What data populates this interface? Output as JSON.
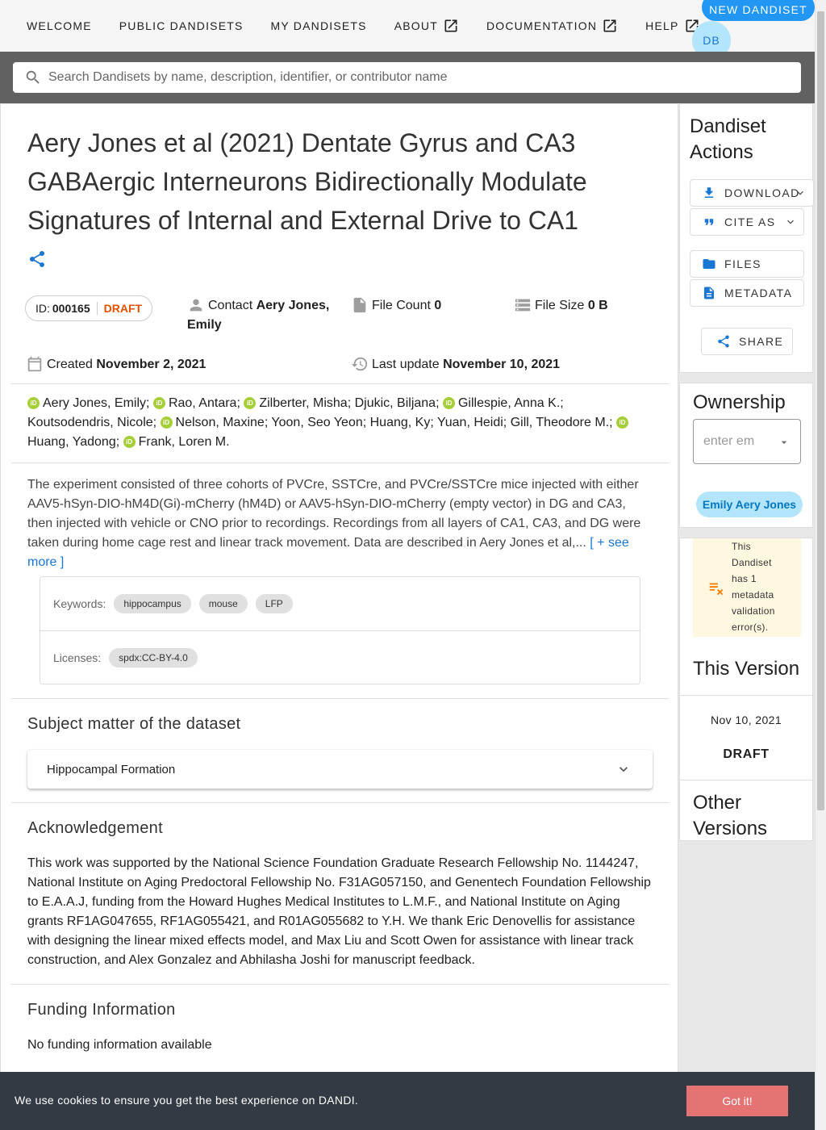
{
  "nav": {
    "items": [
      {
        "label": "WELCOME",
        "external": false
      },
      {
        "label": "PUBLIC DANDISETS",
        "external": false
      },
      {
        "label": "MY DANDISETS",
        "external": false
      },
      {
        "label": "ABOUT",
        "external": true
      },
      {
        "label": "DOCUMENTATION",
        "external": true
      },
      {
        "label": "HELP",
        "external": true
      }
    ],
    "new_dandiset": "NEW DANDISET",
    "avatar_initials": "DB"
  },
  "search": {
    "placeholder": "Search Dandisets by name, description, identifier, or contributor name",
    "value": ""
  },
  "dandiset": {
    "title": "Aery Jones et al (2021) Dentate Gyrus and CA3 GABAergic Interneurons Bidirectionally Modulate Signatures of Internal and External Drive to CA1",
    "id_label": "ID:",
    "id": "000165",
    "status": "DRAFT",
    "contact_label": "Contact",
    "contact_name": "Aery Jones,",
    "contact_name2": "Emily",
    "file_count_label": "File Count",
    "file_count": "0",
    "file_size_label": "File Size",
    "file_size": "0 B",
    "created_label": "Created",
    "created": "November 2, 2021",
    "updated_label": "Last update",
    "updated": "November 10, 2021",
    "contributors": [
      {
        "name": "Aery Jones, Emily",
        "orcid": true
      },
      {
        "name": "Rao, Antara",
        "orcid": true
      },
      {
        "name": "Zilberter, Misha",
        "orcid": true
      },
      {
        "name": "Djukic, Biljana",
        "orcid": false
      },
      {
        "name": "Gillespie, Anna K.",
        "orcid": true
      },
      {
        "name": "Koutsodendris, Nicole",
        "orcid": false
      },
      {
        "name": "Nelson, Maxine",
        "orcid": true
      },
      {
        "name": "Yoon, Seo Yeon",
        "orcid": false
      },
      {
        "name": "Huang, Ky",
        "orcid": false
      },
      {
        "name": "Yuan, Heidi",
        "orcid": false
      },
      {
        "name": "Gill, Theodore M.",
        "orcid": false
      },
      {
        "name": "Huang, Yadong",
        "orcid": true
      },
      {
        "name": "Frank, Loren M.",
        "orcid": true
      }
    ],
    "description": "The experiment consisted of three cohorts of PVCre, SSTCre, and PVCre/SSTCre mice injected with either AAV5-hSyn-DIO-hM4D(Gi)-mCherry (hM4D) or AAV5-hSyn-DIO-mCherry (empty vector) in DG and CA3, then injected with vehicle or CNO prior to recordings. Recordings from all layers of CA1, CA3, and DG were taken during home cage rest and linear track movement. Data are described in Aery Jones et al,...",
    "see_more": "[ + see more ]",
    "keywords_label": "Keywords:",
    "keywords": [
      "hippocampus",
      "mouse",
      "LFP"
    ],
    "licenses_label": "Licenses:",
    "licenses": [
      "spdx:CC-BY-4.0"
    ]
  },
  "subject": {
    "heading": "Subject matter of the dataset",
    "item": "Hippocampal Formation"
  },
  "acknowledgement": {
    "heading": "Acknowledgement",
    "text": "This work was supported by the National Science Foundation Graduate Research Fellowship No. 1144247, National Institute on Aging Predoctoral Fellowship No. F31AG057150, and Genentech Foundation Fellowship to E.A.A.J, funding from the Howard Hughes Medical Institutes to L.M.F., and National Institute on Aging grants RF1AG047655, RF1AG055421, and R01AG055682 to Y.H. We thank Eric Denovellis for assistance with designing the linear mixed effects model, and Max Liu and Scott Owen for assistance with linear track construction, and Alex Gonzalez and Abhilasha Joshi for manuscript feedback."
  },
  "funding": {
    "heading": "Funding Information",
    "text": "No funding information available"
  },
  "actions": {
    "heading_line1": "Dandiset",
    "heading_line2": "Actions",
    "download": "DOWNLOAD",
    "cite_as": "CITE AS",
    "files": "FILES",
    "metadata": "METADATA",
    "share": "SHARE"
  },
  "ownership": {
    "heading": "Ownership",
    "placeholder": "enter em",
    "owner": "Emily Aery Jones"
  },
  "validation": {
    "message": "This Dandiset has 1 metadata validation error(s)."
  },
  "this_version": {
    "heading": "This Version",
    "date": "Nov 10, 2021",
    "label": "DRAFT"
  },
  "other_versions": {
    "heading_line1": "Other",
    "heading_line2": "Versions"
  },
  "cookie": {
    "message": "We use cookies to ensure you get the best experience on DANDI.",
    "button": "Got it!"
  },
  "colors": {
    "primary": "#2196f3",
    "draft": "#e65100",
    "orcid": "#a6ce39",
    "link": "#1976d2",
    "cookie_bg": "#333a43",
    "cookie_button": "#e57373",
    "warning_bg": "#fff8e1",
    "warning_icon": "#f57c00"
  }
}
